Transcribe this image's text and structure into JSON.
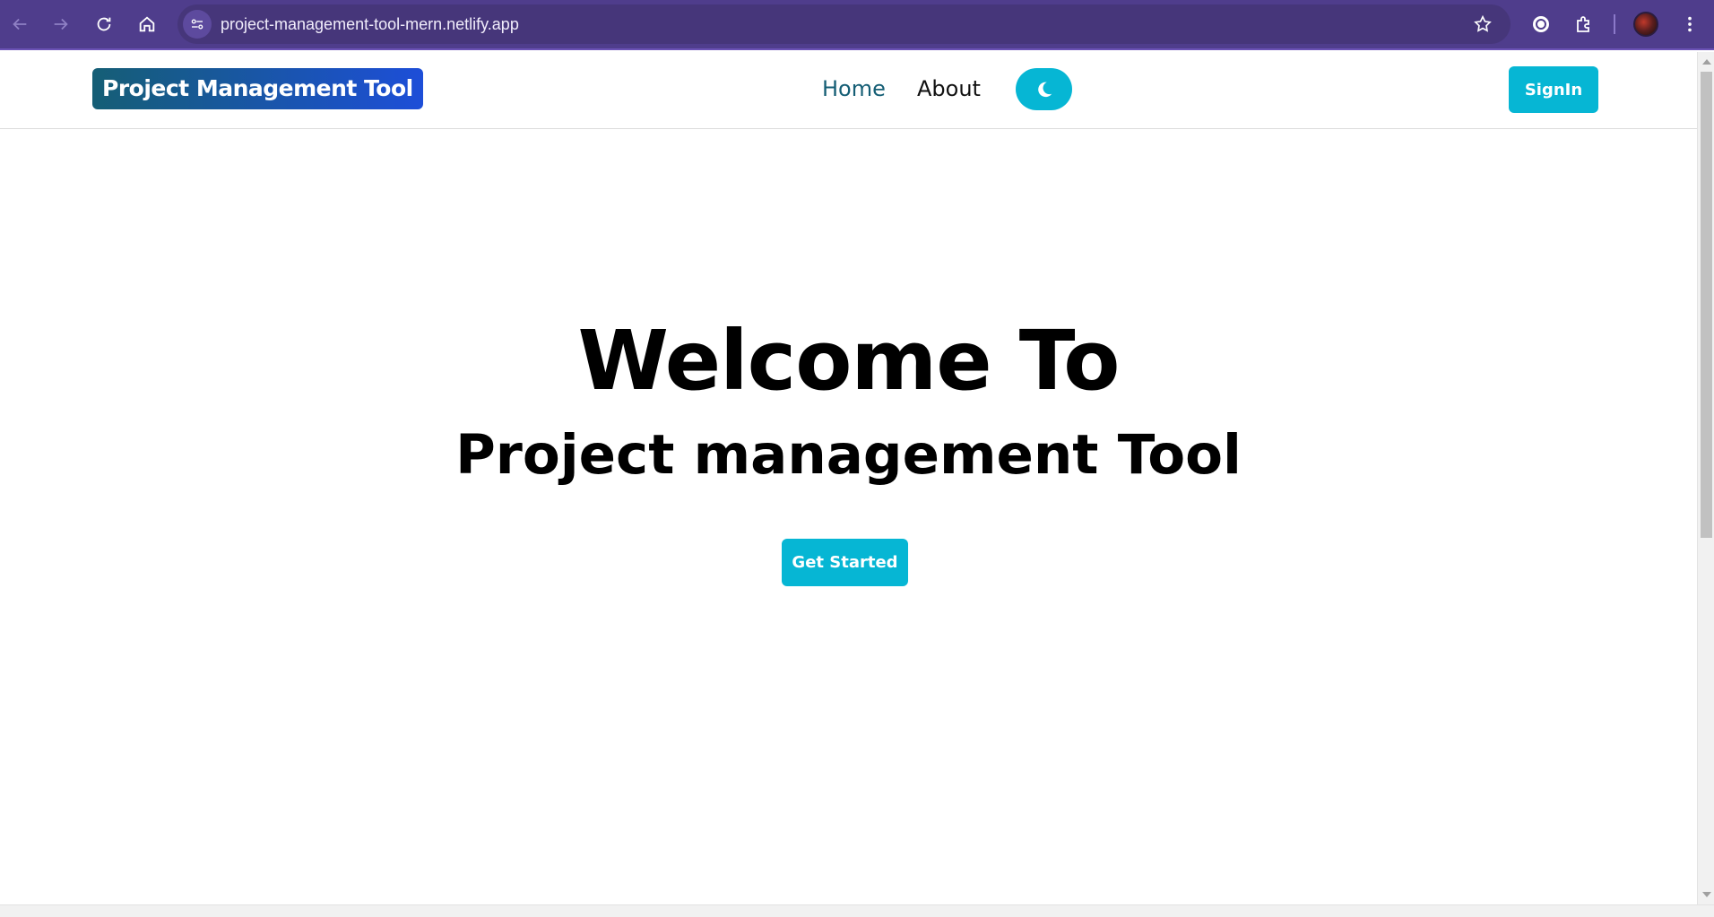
{
  "browser": {
    "url": "project-management-tool-mern.netlify.app",
    "chrome_color": "#4f3d8c",
    "icons": [
      "back-arrow-icon",
      "forward-arrow-icon",
      "reload-icon",
      "home-icon",
      "site-info-icon",
      "star-icon",
      "extension-icon",
      "puzzle-icon",
      "avatar",
      "kebab-menu-icon"
    ]
  },
  "header": {
    "brand": "Project Management Tool",
    "nav": {
      "home": "Home",
      "about": "About"
    },
    "theme_toggle_icon": "moon-icon",
    "signin_label": "SignIn"
  },
  "hero": {
    "title": "Welcome To",
    "subtitle": "Project management Tool",
    "cta_label": "Get Started"
  },
  "colors": {
    "accent": "#06b6d4",
    "active_link": "#155e75",
    "brand_gradient_start": "#155e75",
    "brand_gradient_end": "#1d4ed8"
  }
}
